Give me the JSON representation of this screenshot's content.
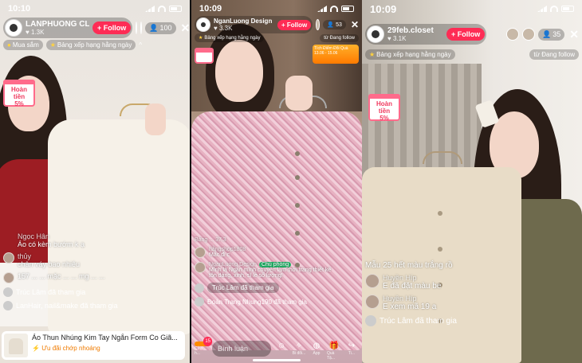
{
  "panel1": {
    "time": "10:10",
    "host": {
      "name": "LANPHUONG CLO...",
      "likes": "1.3K"
    },
    "follow_label": "+ Follow",
    "viewer_count": "100",
    "close": "✕",
    "chips": [
      "Mua sắm",
      "Bảng xếp hạng hằng ngày"
    ],
    "cashback": [
      "Hoàn tiền",
      "5%"
    ],
    "comments": [
      {
        "name": "Ngọc Hân",
        "text": "Áo có kèm bướm k ạ"
      },
      {
        "name": "thủy",
        "text": "chân váy bao nhiêu"
      },
      {
        "name": "",
        "text": "157 ... ... mặc ... ... mg ... ..."
      }
    ],
    "joined": [
      "Trúc Lâm đã tham gia",
      "LanHair, nail&make đã tham gia"
    ],
    "product": {
      "title": "Áo Thun Nhúng Kim Tay Ngắn Form Co Giã...",
      "promo": "Ưu đãi chớp nhoáng"
    }
  },
  "panel2": {
    "time": "10:09",
    "host": {
      "name": "NganLuong Design",
      "likes": "3.3K"
    },
    "follow_label": "+ Follow",
    "viewer_count": "53",
    "close": "✕",
    "chips": [
      "Bảng xếp hạng hằng ngày",
      "từ Đang follow"
    ],
    "event": "Tích Điểm Đổi Quà 13.06 - 15.06",
    "comments": [
      {
        "name": "Bảng ... 37.3",
        "text": ""
      },
      {
        "name": "hằngshop1808",
        "text": "Mắc đi c"
      },
      {
        "name": "NganLuong Design",
        "badge": "Chủ phòng",
        "text": "Mình là Ngân mình chuyên làm thời trang thiết kế tôn dáng, xinh, sĩ lẻ số lượng!"
      }
    ],
    "joined": [
      "Trúc Lâm đã tham gia",
      "Đoàn Trang Nhung190 đã tham gia"
    ],
    "bottom": {
      "cart_badge": "15",
      "cart_label": "Cửa h...",
      "input": "Bình luận",
      "icons": [
        "Bi đổi...",
        "App",
        "Quà Tặ...",
        "Ti..."
      ]
    }
  },
  "panel3": {
    "time": "10:09",
    "host": {
      "name": "29feb.closet",
      "likes": "3.1K"
    },
    "follow_label": "+ Follow",
    "viewer_count": "35",
    "close": "✕",
    "chips": [
      "Bảng xếp hạng hằng ngày",
      "từ Đang follow"
    ],
    "cashback": [
      "Hoàn tiền",
      "5%"
    ],
    "comments": [
      {
        "name": "",
        "text": "Mẫu 25 hết màu trắng rồ"
      },
      {
        "name": "Huyền Híp",
        "text": "E đã đặt màu be"
      },
      {
        "name": "Huyền Híp",
        "text": "E xem mã 19 a"
      }
    ],
    "joined": [
      "Trúc Lâm đã tham gia"
    ]
  },
  "colors": {
    "follow": "#fe2c55",
    "cashback": "#f03a5f",
    "promo": "#f07b00",
    "host_tag": "#25b46a"
  }
}
